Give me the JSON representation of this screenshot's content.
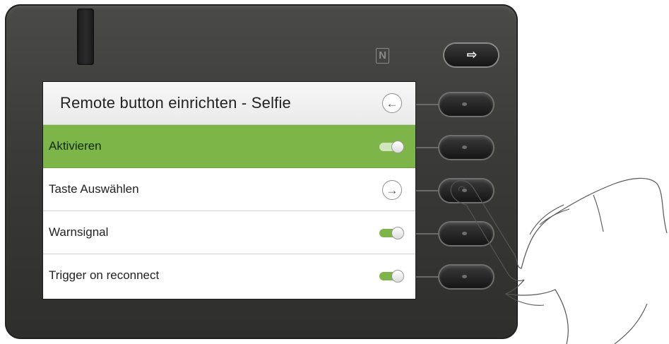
{
  "header": {
    "title": "Remote button einrichten - Selfie",
    "back_icon": "←"
  },
  "rows": [
    {
      "label": "Aktivieren",
      "control": "toggle",
      "state": "on",
      "highlighted": true
    },
    {
      "label": "Taste Auswählen",
      "control": "arrow",
      "icon": "→"
    },
    {
      "label": "Warnsignal",
      "control": "toggle",
      "state": "on"
    },
    {
      "label": "Trigger on reconnect",
      "control": "toggle",
      "state": "on"
    }
  ],
  "device": {
    "nfc_symbol": "N",
    "exit_icon": "⇨"
  },
  "colors": {
    "accent": "#7db548",
    "device_body": "#3a3a38"
  }
}
